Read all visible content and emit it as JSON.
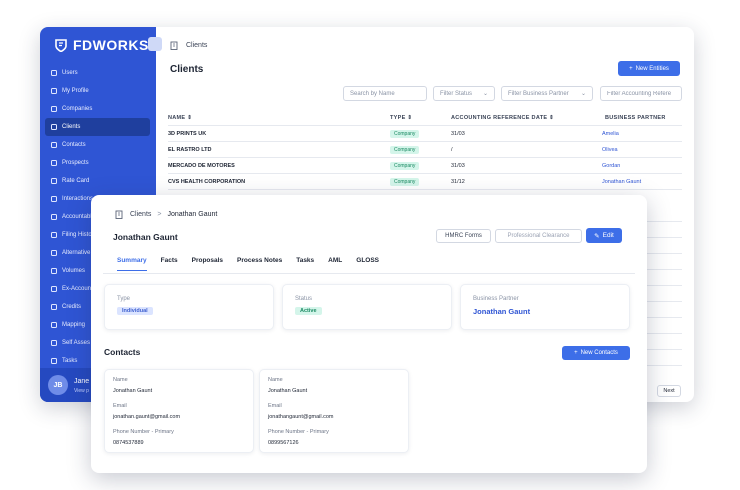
{
  "brand": {
    "name": "FDWORKS"
  },
  "sidebar": {
    "items": [
      {
        "label": "Users",
        "icon": "users-icon"
      },
      {
        "label": "My Profile",
        "icon": "user-icon"
      },
      {
        "label": "Companies",
        "icon": "building-icon"
      },
      {
        "label": "Clients",
        "icon": "clients-icon",
        "active": true
      },
      {
        "label": "Contacts",
        "icon": "contacts-icon"
      },
      {
        "label": "Prospects",
        "icon": "send-icon"
      },
      {
        "label": "Rate Card",
        "icon": "card-icon"
      },
      {
        "label": "Interactions",
        "icon": "interactions-icon"
      },
      {
        "label": "Accountable",
        "icon": "accountable-icon"
      },
      {
        "label": "Filing Histo",
        "icon": "filing-icon"
      },
      {
        "label": "Alternative",
        "icon": "alternative-icon"
      },
      {
        "label": "Volumes",
        "icon": "flask-icon"
      },
      {
        "label": "Ex-Accoun",
        "icon": "ex-account-icon"
      },
      {
        "label": "Credits",
        "icon": "credits-icon"
      },
      {
        "label": "Mapping",
        "icon": "mapping-icon"
      },
      {
        "label": "Self Asses",
        "icon": "self-assessment-icon"
      },
      {
        "label": "Tasks",
        "icon": "tasks-icon"
      }
    ],
    "user": {
      "initials": "JB",
      "name": "Jane",
      "sub": "View p"
    }
  },
  "back": {
    "breadcrumb": "Clients",
    "title": "Clients",
    "new_button": "New Entities",
    "search_placeholder": "Search by Name",
    "filter_status": "Filter Status",
    "filter_partner": "Filter Business Partner",
    "filter_ref": "Filter Accounting Refere",
    "columns": {
      "name": "NAME",
      "type": "TYPE",
      "ref": "ACCOUNTING REFERENCE DATE",
      "partner": "BUSINESS PARTNER"
    },
    "rows": [
      {
        "name": "3D PRINTS UK",
        "type": "Company",
        "ref": "31/03",
        "partner": "Amelia"
      },
      {
        "name": "EL RASTRO LTD",
        "type": "Company",
        "ref": "/",
        "partner": "Olivea"
      },
      {
        "name": "MERCADO DE MOTORES",
        "type": "Company",
        "ref": "31/03",
        "partner": "Gordan"
      },
      {
        "name": "CVS HEALTH CORPORATION",
        "type": "Company",
        "ref": "31/12",
        "partner": "Jonathan Gaunt"
      }
    ],
    "next_label": "Next"
  },
  "front": {
    "breadcrumb_root": "Clients",
    "breadcrumb_sep": ">",
    "breadcrumb_current": "Jonathan Gaunt",
    "title": "Jonathan Gaunt",
    "hmrc_button": "HMRC Forms",
    "clearance_button": "Professional Clearance",
    "edit_button": "Edit",
    "tabs": [
      "Summary",
      "Facts",
      "Proposals",
      "Process Notes",
      "Tasks",
      "AML",
      "GLOSS"
    ],
    "type_label": "Type",
    "type_value": "Individual",
    "status_label": "Status",
    "status_value": "Active",
    "partner_label": "Business Partner",
    "partner_value": "Jonathan Gaunt",
    "contacts_title": "Contacts",
    "new_contacts_button": "New Contacts",
    "contact_field_labels": {
      "name": "Name",
      "email": "Email",
      "phone": "Phone Number - Primary"
    },
    "contacts": [
      {
        "name": "Jonathan Gaunt",
        "email": "jonathan.gaunt@gmail.com",
        "phone": "0874537889"
      },
      {
        "name": "Jonathan Gaunt",
        "email": "jonathangaunt@gmail.com",
        "phone": "0899567126"
      }
    ]
  },
  "colors": {
    "sidebar": "#2f55d4",
    "accent": "#3d6ee8",
    "badge_green": "#d4f5ea",
    "badge_blue": "#dbe4ff"
  }
}
